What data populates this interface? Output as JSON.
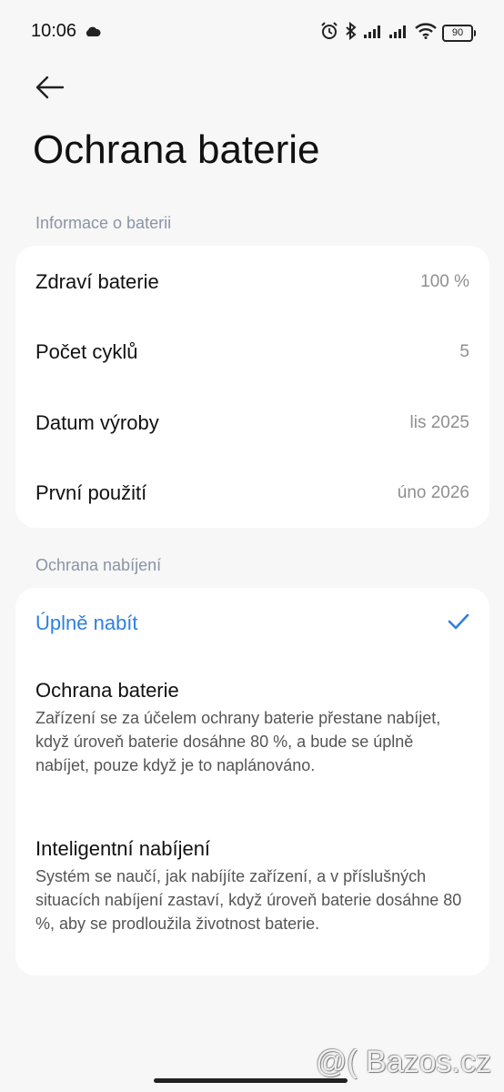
{
  "status_bar": {
    "time": "10:06",
    "battery_level": "90"
  },
  "page": {
    "title": "Ochrana baterie"
  },
  "battery_info": {
    "section_label": "Informace o baterii",
    "rows": [
      {
        "label": "Zdraví baterie",
        "value": "100 %"
      },
      {
        "label": "Počet cyklů",
        "value": "5"
      },
      {
        "label": "Datum výroby",
        "value": "lis 2025"
      },
      {
        "label": "První použití",
        "value": "úno 2026"
      }
    ]
  },
  "charging_protection": {
    "section_label": "Ochrana nabíjení",
    "selected_option": "Úplně nabít",
    "options": [
      {
        "title": "Ochrana baterie",
        "description": "Zařízení se za účelem ochrany baterie přestane nabíjet, když úroveň baterie dosáhne 80 %, a bude se úplně nabíjet, pouze když je to naplánováno."
      },
      {
        "title": "Inteligentní nabíjení",
        "description": "Systém se naučí, jak nabíjíte zařízení, a v příslušných situacích nabíjení zastaví, když úroveň baterie dosáhne 80 %, aby se prodloužila životnost baterie."
      }
    ]
  },
  "colors": {
    "accent": "#2f7fe0",
    "background": "#f7f7f7",
    "card": "#ffffff",
    "section_label": "#8a93a6"
  },
  "watermark": "@( Bazos.cz"
}
